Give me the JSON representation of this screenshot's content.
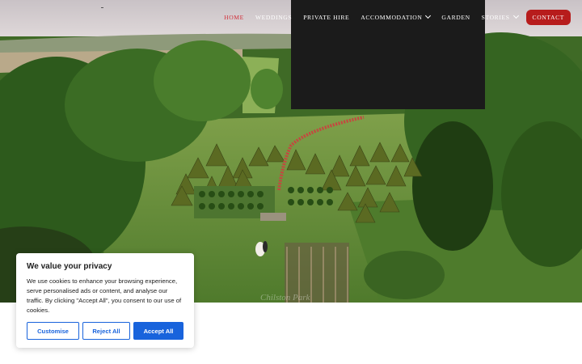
{
  "nav": {
    "items": [
      {
        "label": "HOME",
        "active": true,
        "has_dropdown": false
      },
      {
        "label": "WEDDINGS",
        "active": false,
        "has_dropdown": false
      },
      {
        "label": "PRIVATE HIRE",
        "active": false,
        "has_dropdown": false
      },
      {
        "label": "ACCOMMODATION",
        "active": false,
        "has_dropdown": true
      },
      {
        "label": "GARDEN",
        "active": false,
        "has_dropdown": false
      },
      {
        "label": "STORIES",
        "active": false,
        "has_dropdown": true
      }
    ],
    "contact_label": "CONTACT",
    "active_color": "#d2303a",
    "contact_color": "#b71c1c"
  },
  "hero": {
    "watermark": "Chilston Park"
  },
  "cookie_banner": {
    "title": "We value your privacy",
    "body": "We use cookies to enhance your browsing experience, serve personalised ads or content, and analyse our traffic. By clicking \"Accept All\", you consent to our use of cookies.",
    "customise_label": "Customise",
    "reject_label": "Reject All",
    "accept_label": "Accept All",
    "accent_color": "#1863dc"
  }
}
